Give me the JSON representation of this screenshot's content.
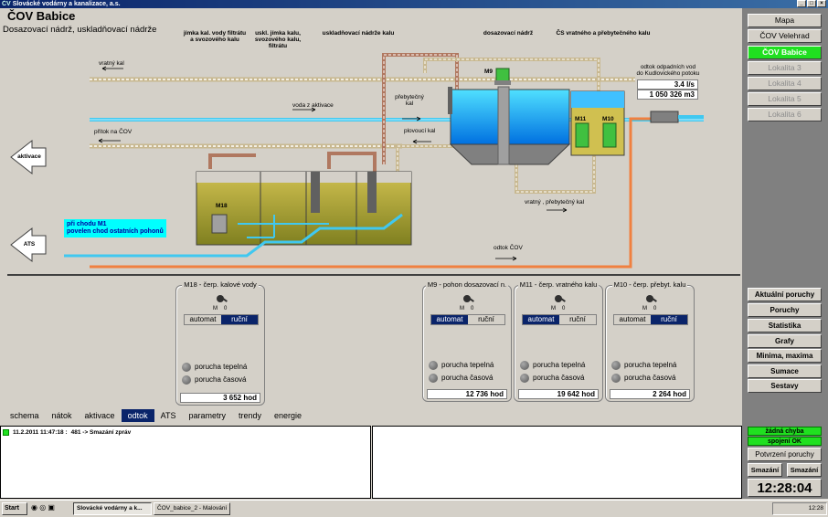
{
  "window": {
    "title": "Slovácké vodárny a kanalizace, a.s.",
    "logo": "ČV",
    "buttons": [
      "_",
      "□",
      "×"
    ]
  },
  "page": {
    "title": "ČOV Babice",
    "subtitle": "Dosazovací nádrž, uskladňovací nádrže"
  },
  "diagram": {
    "labels": {
      "jimka_kal": "jímka kal. vody filtrátu\na svozového kalu",
      "uskl_jimka": "uskl. jímka kalu,\nsvozového kalu,\nfiltrátu",
      "uskladnovaci": "uskladňovací nádrže kalu",
      "dosazovaci": "dosazovací nádrž",
      "cs_vratneho": "ČS vratného a přebytečného kalu",
      "odtok_text": "odtok odpadních vod\ndo Kudlovického potoku",
      "vratny_kal": "vratný kal",
      "voda_z_aktivace": "voda z aktivace",
      "pritok_na_cov": "přítok na ČOV",
      "prebytecny_kal": "přebytečný\nkal",
      "plovouci_kal": "plovoucí kal",
      "vratny_prebytecny": "vratný , přebytečný kal",
      "odtok_cov": "odtok ČOV",
      "aktivace": "aktivace",
      "ats": "ATS",
      "m9": "M9",
      "m11": "M11",
      "m10": "M10",
      "m18": "M18",
      "notice": "při chodu M1\npovelen chod ostatních pohonů"
    },
    "values": {
      "flow": "3.4 l/s",
      "total": "1 050 326 m3"
    },
    "colors": {
      "water": "#00b4ff",
      "sludge": "#c8b040",
      "pipe_brown": "#b07860",
      "pipe_cyan": "#40c8f0",
      "pipe_orange": "#f08040"
    }
  },
  "nav": {
    "items": [
      {
        "label": "Mapa",
        "state": "normal"
      },
      {
        "label": "ČOV Velehrad",
        "state": "normal"
      },
      {
        "label": "ČOV Babice",
        "state": "active"
      },
      {
        "label": "Lokalita 3",
        "state": "disabled"
      },
      {
        "label": "Lokalita 4",
        "state": "disabled"
      },
      {
        "label": "Lokalita 5",
        "state": "disabled"
      },
      {
        "label": "Lokalita 6",
        "state": "disabled"
      }
    ]
  },
  "functions": {
    "items": [
      "Aktuální poruchy",
      "Poruchy",
      "Statistika",
      "Grafy",
      "Minima, maxima",
      "Sumace",
      "Sestavy"
    ]
  },
  "pumps": [
    {
      "title": "M18 - čerp. kalové vody",
      "mode_a": "automat",
      "mode_b": "ruční",
      "selected": "ruční",
      "fault1": "porucha tepelná",
      "fault2": "porucha časová",
      "hours": "3 652 hod"
    },
    {
      "title": "M9 - pohon dosazovací n.",
      "mode_a": "automat",
      "mode_b": "ruční",
      "selected": "automat",
      "fault1": "porucha tepelná",
      "fault2": "porucha časová",
      "hours": "12 736 hod"
    },
    {
      "title": "M11 - čerp. vratného kalu",
      "mode_a": "automat",
      "mode_b": "ruční",
      "selected": "automat",
      "fault1": "porucha tepelná",
      "fault2": "porucha časová",
      "hours": "19 642 hod"
    },
    {
      "title": "M10 - čerp. přebyt. kalu",
      "mode_a": "automat",
      "mode_b": "ruční",
      "selected": "ruční",
      "fault1": "porucha tepelná",
      "fault2": "porucha časová",
      "hours": "2 264 hod"
    }
  ],
  "switch_labels": {
    "m": "M",
    "o": "0"
  },
  "tabs": [
    {
      "label": "schema",
      "active": false
    },
    {
      "label": "nátok",
      "active": false
    },
    {
      "label": "aktivace",
      "active": false
    },
    {
      "label": "odtok",
      "active": true
    },
    {
      "label": "ATS",
      "active": false
    },
    {
      "label": "parametry",
      "active": false
    },
    {
      "label": "trendy",
      "active": false
    },
    {
      "label": "energie",
      "active": false
    }
  ],
  "log": {
    "entries": [
      {
        "time": "11.2.2011 11:47:18 :",
        "text": "481 -> Smazání zpráv"
      }
    ]
  },
  "status": {
    "line1": "žádná chyba",
    "line2": "spojení OK"
  },
  "actions": {
    "confirm": "Potvrzení poruchy",
    "delete1": "Smazání",
    "delete2": "Smazání"
  },
  "clock": "12:28:04",
  "taskbar": {
    "start": "Start",
    "items": [
      {
        "label": "Slovácké vodárny a k...",
        "pressed": true
      },
      {
        "label": "ČOV_babice_2 - Malování",
        "pressed": false
      }
    ],
    "tray_time": "12:28"
  }
}
